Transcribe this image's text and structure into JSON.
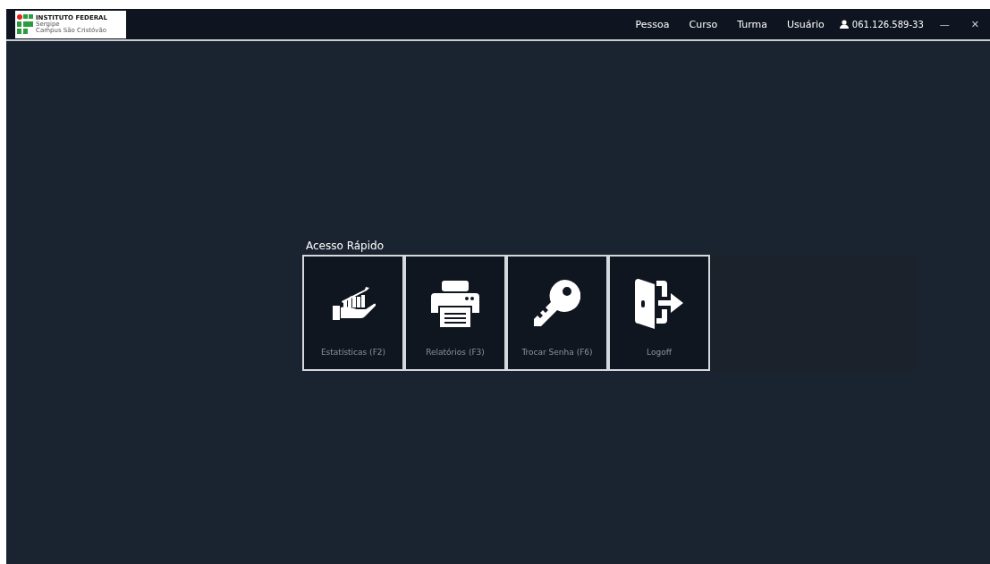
{
  "logo": {
    "title": "INSTITUTO FEDERAL",
    "subtitle": "Sergipe",
    "campus": "Campus São Cristóvão"
  },
  "menu": [
    "Pessoa",
    "Curso",
    "Turma",
    "Usuário"
  ],
  "user": {
    "label": "061.126.589-33"
  },
  "window_controls": {
    "minimize": "—",
    "close": "✕"
  },
  "quick_access": {
    "title": "Acesso Rápido",
    "tiles": [
      {
        "label": "Estatísticas (F2)",
        "kind": "chart"
      },
      {
        "label": "Relatórios (F3)",
        "kind": "printer"
      },
      {
        "label": "Trocar Senha (F6)",
        "kind": "key"
      },
      {
        "label": "Logoff",
        "kind": "exit"
      }
    ]
  }
}
